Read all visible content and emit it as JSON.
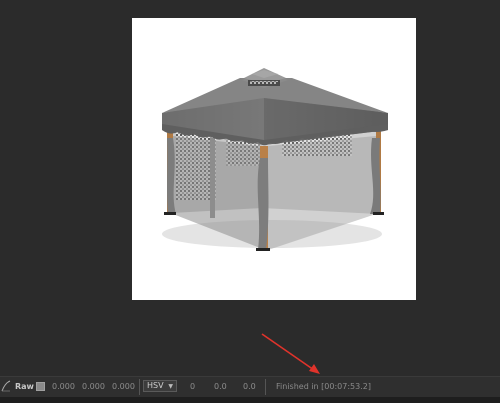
{
  "status_bar": {
    "raw_label": "Raw",
    "channel_values": [
      "0.000",
      "0.000",
      "0.000"
    ],
    "color_mode": "HSV",
    "hsv_values": [
      "0",
      "0.0",
      "0.0"
    ],
    "render_status": "Finished in [00:07:53.2]"
  },
  "colors": {
    "background": "#2b2b2b",
    "annotation_arrow": "#e0332b"
  }
}
